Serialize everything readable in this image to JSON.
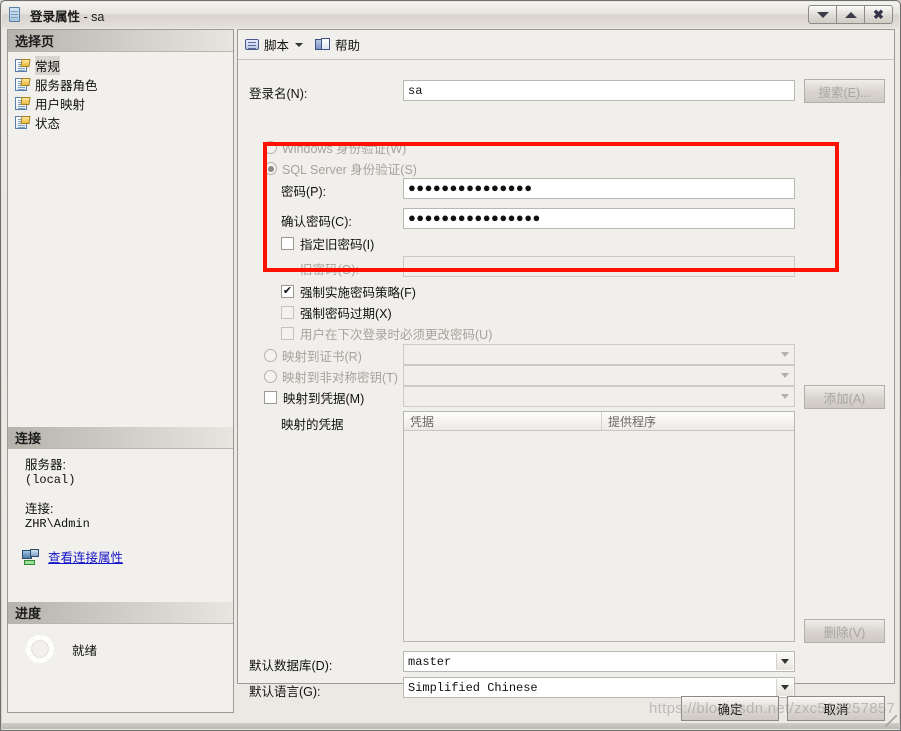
{
  "window": {
    "title": "登录属性",
    "title_separator": " - ",
    "title_object": "sa",
    "icon": "document-icon",
    "minimize_label": "▼",
    "maximize_label": "▲",
    "close_label": "✖"
  },
  "sidebar": {
    "select_page_header": "选择页",
    "items": [
      {
        "label": "常规",
        "selected": true
      },
      {
        "label": "服务器角色",
        "selected": false
      },
      {
        "label": "用户映射",
        "selected": false
      },
      {
        "label": "状态",
        "selected": false
      }
    ],
    "connection": {
      "header": "连接",
      "server_label": "服务器:",
      "server_value": "(local)",
      "connection_label": "连接:",
      "connection_value": "ZHR\\Admin",
      "view_properties_link": "查看连接属性"
    },
    "progress": {
      "header": "进度",
      "status": "就绪"
    }
  },
  "toolbar": {
    "script_label": "脚本",
    "help_label": "帮助"
  },
  "form": {
    "login_name_label": "登录名(N):",
    "login_name_value": "sa",
    "search_button": "搜索(E)...",
    "windows_auth_label": "Windows 身份验证(W)",
    "sql_auth_label": "SQL Server 身份验证(S)",
    "password_label": "密码(P):",
    "password_value": "●●●●●●●●●●●●●●●",
    "confirm_password_label": "确认密码(C):",
    "confirm_password_value": "●●●●●●●●●●●●●●●●",
    "specify_old_password_label": "指定旧密码(I)",
    "old_password_label": "旧密码(O):",
    "old_password_value": "",
    "enforce_policy_label": "强制实施密码策略(F)",
    "enforce_expiration_label": "强制密码过期(X)",
    "must_change_label": "用户在下次登录时必须更改密码(U)",
    "map_to_certificate_label": "映射到证书(R)",
    "map_to_certificate_value": "",
    "map_to_asymmetric_key_label": "映射到非对称密钥(T)",
    "map_to_asymmetric_key_value": "",
    "map_to_credential_label": "映射到凭据(M)",
    "map_to_credential_value": "",
    "add_button": "添加(A)",
    "mapped_credentials_label": "映射的凭据",
    "grid_columns": [
      "凭据",
      "提供程序"
    ],
    "grid_rows": [],
    "delete_button": "删除(V)",
    "default_database_label": "默认数据库(D):",
    "default_database_value": "master",
    "default_language_label": "默认语言(G):",
    "default_language_value": "Simplified Chinese"
  },
  "footer": {
    "ok_button": "确定",
    "cancel_button": "取消"
  },
  "annotation": {
    "color": "#ff1100",
    "note": "highlight-box-around-password-section"
  },
  "watermark": {
    "text": "https://blog.csdn.net/zxc514257857"
  }
}
